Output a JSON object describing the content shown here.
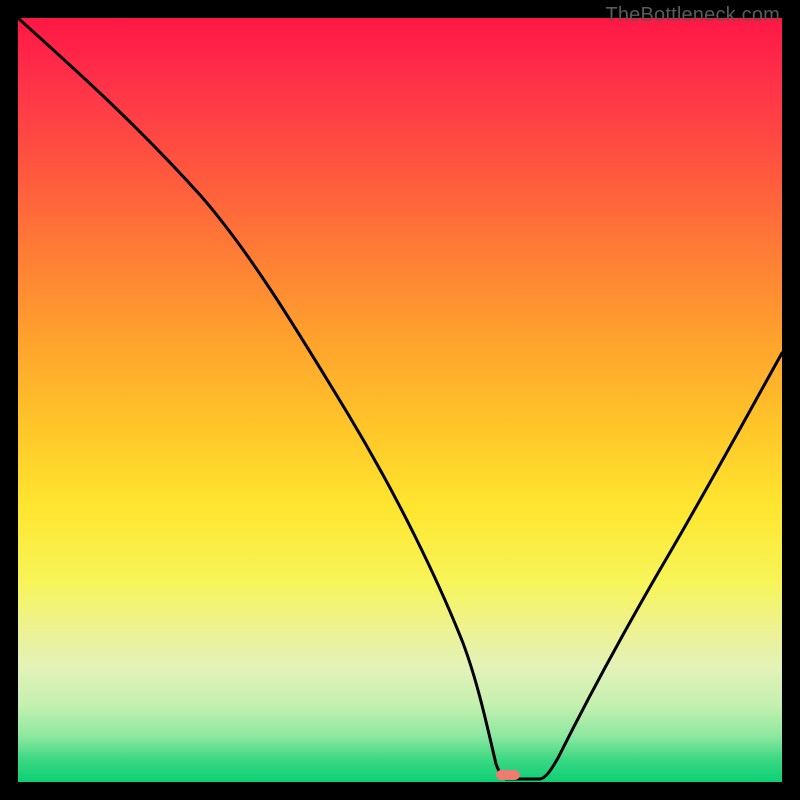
{
  "watermark": "TheBottleneck.com",
  "colors": {
    "frame": "#000000",
    "curve": "#000000",
    "marker": "#ef7a6f",
    "gradient_top": "#ff1744",
    "gradient_bottom": "#0bd074"
  },
  "chart_data": {
    "type": "line",
    "title": "",
    "xlabel": "",
    "ylabel": "",
    "xlim": [
      0,
      100
    ],
    "ylim": [
      0,
      100
    ],
    "x": [
      0,
      6,
      12,
      18,
      24,
      29,
      34,
      40,
      46,
      52,
      57,
      60.5,
      62.5,
      65.5,
      68.5,
      72.5,
      78.5,
      85,
      92,
      100
    ],
    "values": [
      100,
      93,
      86,
      79,
      72,
      66.5,
      58,
      49,
      40,
      30,
      20,
      11,
      3,
      0.5,
      0.5,
      3,
      13,
      26,
      40,
      57
    ],
    "marker": {
      "x": 64,
      "y": 0.4
    }
  }
}
